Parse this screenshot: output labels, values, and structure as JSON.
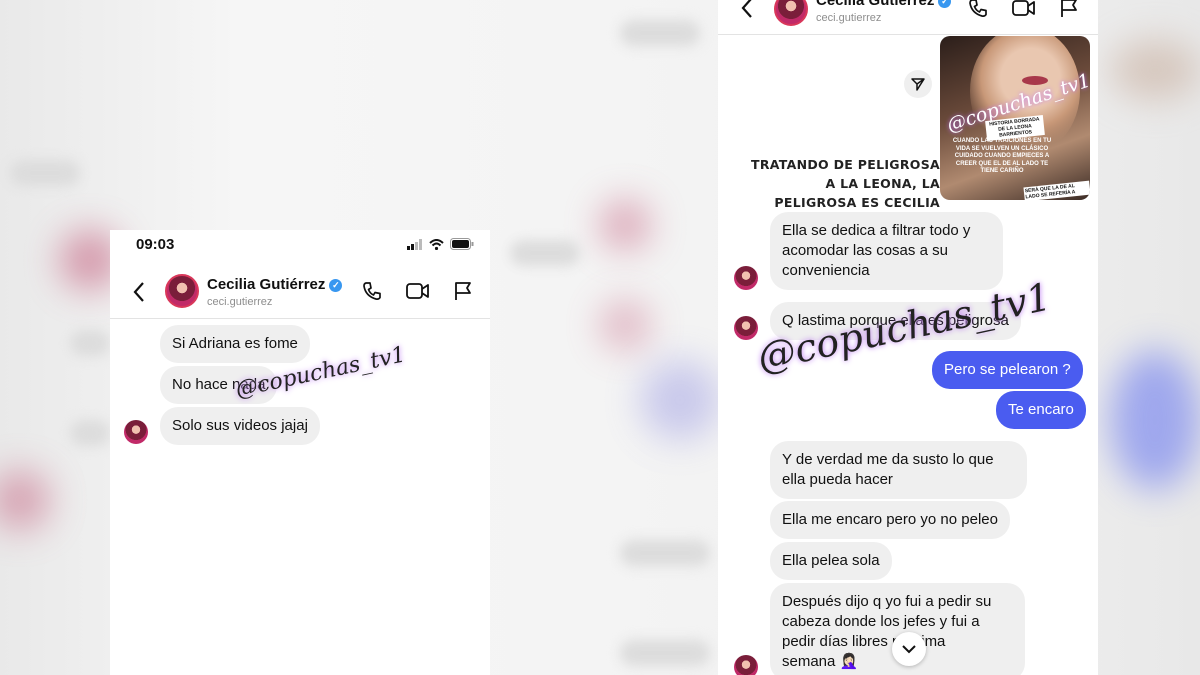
{
  "left_phone": {
    "status_time": "09:03",
    "contact": {
      "name": "Cecilia Gutiérrez",
      "handle": "ceci.gutierrez"
    },
    "messages": [
      "Si Adriana es fome",
      "No hace nada",
      "Solo sus videos jajaj"
    ],
    "watermark": "@copuchas_tv1"
  },
  "right_phone": {
    "contact": {
      "name": "Cecilia Gutiérrez",
      "handle": "ceci.gutierrez"
    },
    "story": {
      "watermark": "@copuchas_tv1",
      "label_top": "HISTORIA BORRADA DE LA LEONA BARRIENTOS",
      "text": "CUANDO LAS TRAICIONES EN TU VIDA SE VUELVEN UN CLÁSICO CUIDADO CUANDO EMPIECES A CREER QUE EL DE AL LADO TE TIENE CARIÑO",
      "label_bottom": "SERÁ QUE LA DE AL LADO SE REFERÍA A"
    },
    "story_caption": "TRATANDO DE PELIGROSA A LA LEONA, LA PELIGROSA ES CECILIA",
    "messages": {
      "m1_line1": "Ella se dedica a filtrar todo y",
      "m1_line2": "acomodar las cosas a su",
      "m1_line3": "conveniencia",
      "m2": "Q lastima porque ella es peligrosa",
      "m3": "Pero se pelearon ?",
      "m4": "Te encaro",
      "m5_line1": "Y de verdad me da susto lo que",
      "m5_line2": "ella pueda hacer",
      "m6": "Ella me encaro pero yo no peleo",
      "m7": "Ella pelea sola",
      "m8_line1": "Después dijo q yo fui a pedir su",
      "m8_line2": "cabeza donde los jefes y fui a",
      "m8_line3": "pedir días libres próxima",
      "m8_line4": "semana 🤦🏻‍♀️"
    },
    "watermark": "@copuchas_tv1"
  },
  "colors": {
    "sent_bubble": "#4a5cf0",
    "received_bubble": "#efefef",
    "verified": "#3897f0"
  }
}
